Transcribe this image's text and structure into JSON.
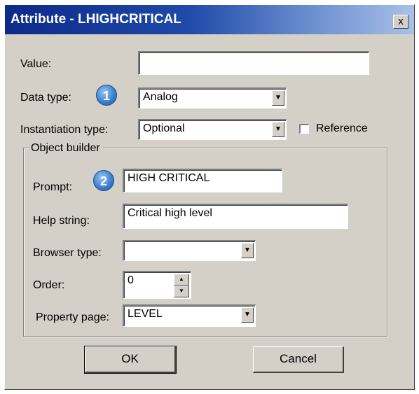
{
  "window": {
    "title": "Attribute - LHIGHCRITICAL",
    "close_label": "x"
  },
  "fields": {
    "value_label": "Value:",
    "value": "",
    "data_type_label": "Data type:",
    "data_type_value": "Analog",
    "data_type_badge": "1",
    "instantiation_label": "Instantiation type:",
    "instantiation_value": "Optional",
    "reference_label": "Reference"
  },
  "object_builder": {
    "title": "Object builder",
    "prompt_label": "Prompt:",
    "prompt_badge": "2",
    "prompt_value": "HIGH CRITICAL",
    "help_label": "Help string:",
    "help_value": "Critical high level",
    "browser_label": "Browser type:",
    "browser_value": "",
    "order_label": "Order:",
    "order_value": "0",
    "property_label": "Property page:",
    "property_value": "LEVEL"
  },
  "buttons": {
    "ok": "OK",
    "cancel": "Cancel"
  },
  "icons": {
    "dropdown": "chevron-down-icon",
    "spin_up": "spin-up-icon",
    "spin_down": "spin-down-icon",
    "close": "close-icon"
  }
}
